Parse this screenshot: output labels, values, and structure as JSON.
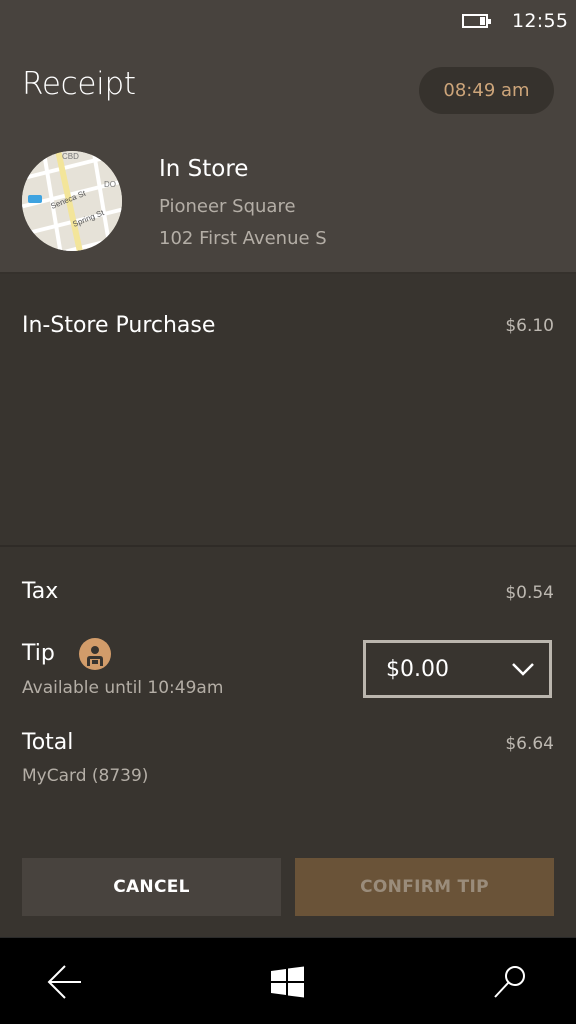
{
  "status_bar": {
    "battery_icon": "battery-icon",
    "time": "12:55"
  },
  "header": {
    "title": "Receipt",
    "time": "08:49 am"
  },
  "store": {
    "map_icon": "map-thumbnail",
    "map_labels": [
      "CBD",
      "Seneca St",
      "Spring St",
      "DO"
    ],
    "type": "In Store",
    "area": "Pioneer Square",
    "address": "102 First Avenue S"
  },
  "items": [
    {
      "name": "In-Store Purchase",
      "price": "$6.10"
    }
  ],
  "summary": {
    "tax_label": "Tax",
    "tax_value": "$0.54",
    "tip_label": "Tip",
    "tip_icon": "barista-icon",
    "tip_availability": "Available until 10:49am",
    "tip_selected": "$0.00",
    "total_label": "Total",
    "total_value": "$6.64",
    "payment_method": "MyCard (8739)"
  },
  "actions": {
    "cancel_label": "CANCEL",
    "confirm_label": "CONFIRM TIP"
  },
  "navbar": {
    "back_icon": "back-arrow-icon",
    "home_icon": "windows-logo-icon",
    "search_icon": "search-icon"
  },
  "colors": {
    "accent": "#cda57a",
    "header_bg": "#48433e",
    "body_bg": "#38342f",
    "confirm_bg": "#6a5338"
  }
}
